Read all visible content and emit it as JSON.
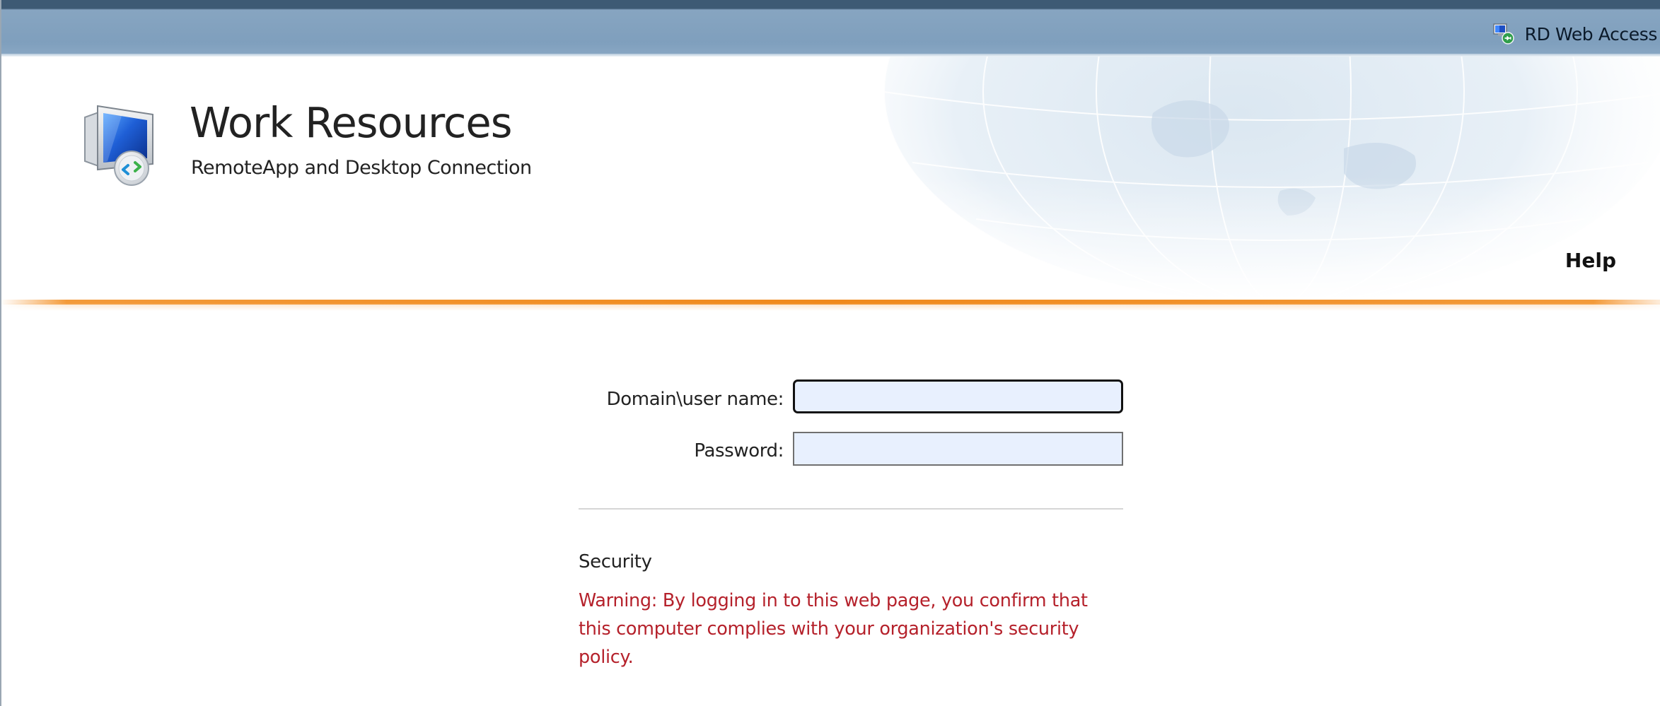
{
  "topbar": {
    "brand_label": "RD Web Access",
    "brand_icon": "rd-web-access-icon"
  },
  "header": {
    "title": "Work Resources",
    "subtitle": "RemoteApp and Desktop Connection",
    "app_icon": "remote-desktop-monitor-icon",
    "help_label": "Help"
  },
  "login": {
    "username_label": "Domain\\user name:",
    "username_value": "",
    "password_label": "Password:",
    "password_value": ""
  },
  "security": {
    "heading": "Security",
    "warning": "Warning: By logging in to this web page, you confirm that this computer complies with your organization's security policy."
  },
  "colors": {
    "topbar": "#7f9fbd",
    "accent_orange": "#f0891c",
    "warning_red": "#b5212b",
    "input_fill": "#e8f0fe"
  }
}
